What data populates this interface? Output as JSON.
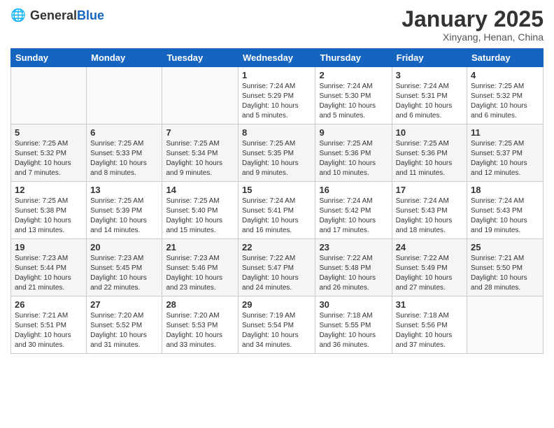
{
  "logo": {
    "general": "General",
    "blue": "Blue"
  },
  "title": "January 2025",
  "subtitle": "Xinyang, Henan, China",
  "days_of_week": [
    "Sunday",
    "Monday",
    "Tuesday",
    "Wednesday",
    "Thursday",
    "Friday",
    "Saturday"
  ],
  "weeks": [
    [
      {
        "day": "",
        "info": ""
      },
      {
        "day": "",
        "info": ""
      },
      {
        "day": "",
        "info": ""
      },
      {
        "day": "1",
        "info": "Sunrise: 7:24 AM\nSunset: 5:29 PM\nDaylight: 10 hours\nand 5 minutes."
      },
      {
        "day": "2",
        "info": "Sunrise: 7:24 AM\nSunset: 5:30 PM\nDaylight: 10 hours\nand 5 minutes."
      },
      {
        "day": "3",
        "info": "Sunrise: 7:24 AM\nSunset: 5:31 PM\nDaylight: 10 hours\nand 6 minutes."
      },
      {
        "day": "4",
        "info": "Sunrise: 7:25 AM\nSunset: 5:32 PM\nDaylight: 10 hours\nand 6 minutes."
      }
    ],
    [
      {
        "day": "5",
        "info": "Sunrise: 7:25 AM\nSunset: 5:32 PM\nDaylight: 10 hours\nand 7 minutes."
      },
      {
        "day": "6",
        "info": "Sunrise: 7:25 AM\nSunset: 5:33 PM\nDaylight: 10 hours\nand 8 minutes."
      },
      {
        "day": "7",
        "info": "Sunrise: 7:25 AM\nSunset: 5:34 PM\nDaylight: 10 hours\nand 9 minutes."
      },
      {
        "day": "8",
        "info": "Sunrise: 7:25 AM\nSunset: 5:35 PM\nDaylight: 10 hours\nand 9 minutes."
      },
      {
        "day": "9",
        "info": "Sunrise: 7:25 AM\nSunset: 5:36 PM\nDaylight: 10 hours\nand 10 minutes."
      },
      {
        "day": "10",
        "info": "Sunrise: 7:25 AM\nSunset: 5:36 PM\nDaylight: 10 hours\nand 11 minutes."
      },
      {
        "day": "11",
        "info": "Sunrise: 7:25 AM\nSunset: 5:37 PM\nDaylight: 10 hours\nand 12 minutes."
      }
    ],
    [
      {
        "day": "12",
        "info": "Sunrise: 7:25 AM\nSunset: 5:38 PM\nDaylight: 10 hours\nand 13 minutes."
      },
      {
        "day": "13",
        "info": "Sunrise: 7:25 AM\nSunset: 5:39 PM\nDaylight: 10 hours\nand 14 minutes."
      },
      {
        "day": "14",
        "info": "Sunrise: 7:25 AM\nSunset: 5:40 PM\nDaylight: 10 hours\nand 15 minutes."
      },
      {
        "day": "15",
        "info": "Sunrise: 7:24 AM\nSunset: 5:41 PM\nDaylight: 10 hours\nand 16 minutes."
      },
      {
        "day": "16",
        "info": "Sunrise: 7:24 AM\nSunset: 5:42 PM\nDaylight: 10 hours\nand 17 minutes."
      },
      {
        "day": "17",
        "info": "Sunrise: 7:24 AM\nSunset: 5:43 PM\nDaylight: 10 hours\nand 18 minutes."
      },
      {
        "day": "18",
        "info": "Sunrise: 7:24 AM\nSunset: 5:43 PM\nDaylight: 10 hours\nand 19 minutes."
      }
    ],
    [
      {
        "day": "19",
        "info": "Sunrise: 7:23 AM\nSunset: 5:44 PM\nDaylight: 10 hours\nand 21 minutes."
      },
      {
        "day": "20",
        "info": "Sunrise: 7:23 AM\nSunset: 5:45 PM\nDaylight: 10 hours\nand 22 minutes."
      },
      {
        "day": "21",
        "info": "Sunrise: 7:23 AM\nSunset: 5:46 PM\nDaylight: 10 hours\nand 23 minutes."
      },
      {
        "day": "22",
        "info": "Sunrise: 7:22 AM\nSunset: 5:47 PM\nDaylight: 10 hours\nand 24 minutes."
      },
      {
        "day": "23",
        "info": "Sunrise: 7:22 AM\nSunset: 5:48 PM\nDaylight: 10 hours\nand 26 minutes."
      },
      {
        "day": "24",
        "info": "Sunrise: 7:22 AM\nSunset: 5:49 PM\nDaylight: 10 hours\nand 27 minutes."
      },
      {
        "day": "25",
        "info": "Sunrise: 7:21 AM\nSunset: 5:50 PM\nDaylight: 10 hours\nand 28 minutes."
      }
    ],
    [
      {
        "day": "26",
        "info": "Sunrise: 7:21 AM\nSunset: 5:51 PM\nDaylight: 10 hours\nand 30 minutes."
      },
      {
        "day": "27",
        "info": "Sunrise: 7:20 AM\nSunset: 5:52 PM\nDaylight: 10 hours\nand 31 minutes."
      },
      {
        "day": "28",
        "info": "Sunrise: 7:20 AM\nSunset: 5:53 PM\nDaylight: 10 hours\nand 33 minutes."
      },
      {
        "day": "29",
        "info": "Sunrise: 7:19 AM\nSunset: 5:54 PM\nDaylight: 10 hours\nand 34 minutes."
      },
      {
        "day": "30",
        "info": "Sunrise: 7:18 AM\nSunset: 5:55 PM\nDaylight: 10 hours\nand 36 minutes."
      },
      {
        "day": "31",
        "info": "Sunrise: 7:18 AM\nSunset: 5:56 PM\nDaylight: 10 hours\nand 37 minutes."
      },
      {
        "day": "",
        "info": ""
      }
    ]
  ]
}
